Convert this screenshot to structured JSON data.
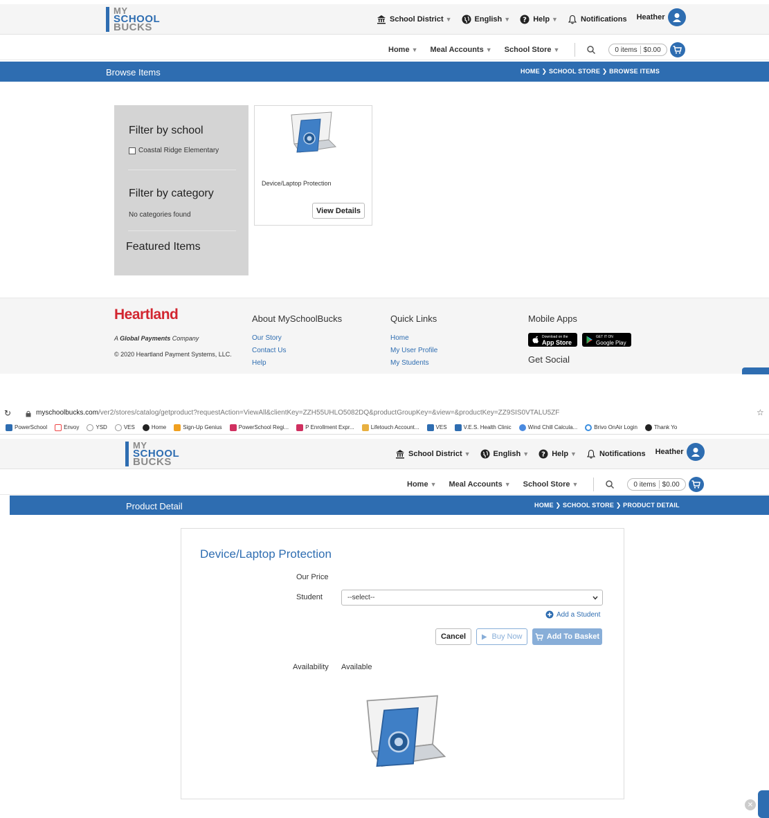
{
  "header": {
    "logo": {
      "line1": "MY",
      "line2": "SCHOOL",
      "line3": "BUCKS"
    },
    "util": {
      "district": "School District",
      "language": "English",
      "help": "Help",
      "notifications": "Notifications",
      "user": "Heather"
    },
    "nav": {
      "home": "Home",
      "meal": "Meal Accounts",
      "store": "School Store"
    },
    "cart": {
      "items": "0 items",
      "total": "$0.00"
    }
  },
  "browse": {
    "title": "Browse Items",
    "breadcrumb": "HOME  ❯  SCHOOL STORE  ❯  BROWSE ITEMS",
    "filter_school_title": "Filter by school",
    "school_option": "Coastal Ridge Elementary",
    "filter_category_title": "Filter by category",
    "no_categories": "No categories found",
    "featured_title": "Featured Items",
    "product_name": "Device/Laptop Protection",
    "view_details": "View Details"
  },
  "footer": {
    "brand": "Heartland",
    "tagline_bold": "Global Payments",
    "tagline_pre": "A ",
    "tagline_post": " Company",
    "copyright": "© 2020 Heartland Payment Systems, LLC.",
    "about_title": "About MySchoolBucks",
    "about_links": [
      "Our Story",
      "Contact Us",
      "Help"
    ],
    "quick_title": "Quick Links",
    "quick_links": [
      "Home",
      "My User Profile",
      "My Students"
    ],
    "apps_title": "Mobile Apps",
    "app_store_small": "Download on the",
    "app_store": "App Store",
    "google_small": "GET IT ON",
    "google_play": "Google Play",
    "social_title": "Get Social"
  },
  "browser": {
    "url_host": "myschoolbucks.com",
    "url_path": "/ver2/stores/catalog/getproduct?requestAction=ViewAll&clientKey=ZZH55UHLO5082DQ&productGroupKey=&view=&productKey=ZZ9SIS0VTALU5ZF",
    "bookmarks": [
      "PowerSchool",
      "Envoy",
      "YSD",
      "VES",
      "Home",
      "Sign-Up Genius",
      "PowerSchool Regi...",
      "P Enrollment Expr...",
      "Lifetouch Account...",
      "VES",
      "V.E.S. Health Clinic",
      "Wind Chill Calcula...",
      "Brivo OnAir Login",
      "Thank Yo"
    ]
  },
  "detail": {
    "title": "Product Detail",
    "breadcrumb": "HOME  ❯  SCHOOL STORE  ❯  PRODUCT DETAIL",
    "product_name": "Device/Laptop Protection",
    "our_price": "Our Price",
    "student_label": "Student",
    "student_select": "--select--",
    "add_student": "Add a Student",
    "cancel": "Cancel",
    "buy_now": "Buy Now",
    "add_to_basket": "Add To Basket",
    "availability_label": "Availability",
    "availability_value": "Available"
  },
  "colors": {
    "brand_blue": "#2e6db1",
    "heartland_red": "#d22630",
    "disabled_blue": "#88aed8"
  }
}
